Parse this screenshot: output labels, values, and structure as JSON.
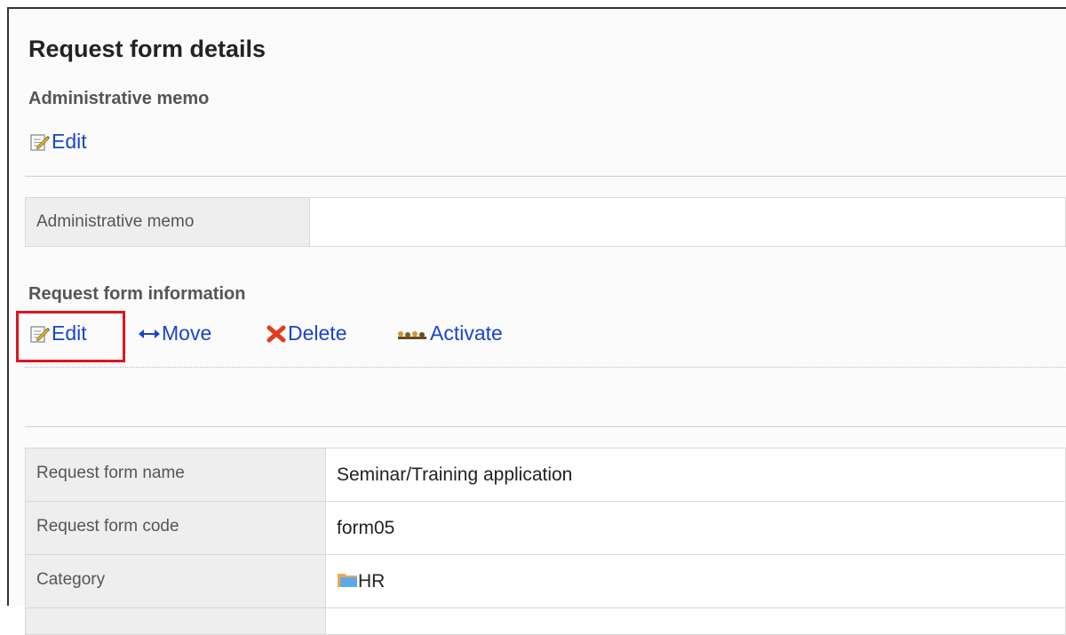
{
  "page": {
    "title": "Request form details"
  },
  "admin_memo": {
    "section_title": "Administrative memo",
    "edit_label": "Edit",
    "table_label": "Administrative memo",
    "table_value": ""
  },
  "request_info": {
    "section_title": "Request form information",
    "actions": {
      "edit": "Edit",
      "move": "Move",
      "delete": "Delete",
      "activate": "Activate"
    },
    "rows": [
      {
        "label": "Request form name",
        "value": "Seminar/Training application"
      },
      {
        "label": "Request form code",
        "value": "form05"
      },
      {
        "label": "Category",
        "value": "HR",
        "icon": "folder-icon"
      }
    ]
  },
  "icons": {
    "edit": "edit-pencil-icon",
    "move": "move-arrows-icon",
    "delete": "delete-x-icon",
    "activate": "activate-icon",
    "category": "folder-icon"
  },
  "colors": {
    "link": "#1a44cc",
    "highlight": "#e0141e",
    "delete_icon": "#e23b1e",
    "label_bg": "#eeeeee"
  }
}
